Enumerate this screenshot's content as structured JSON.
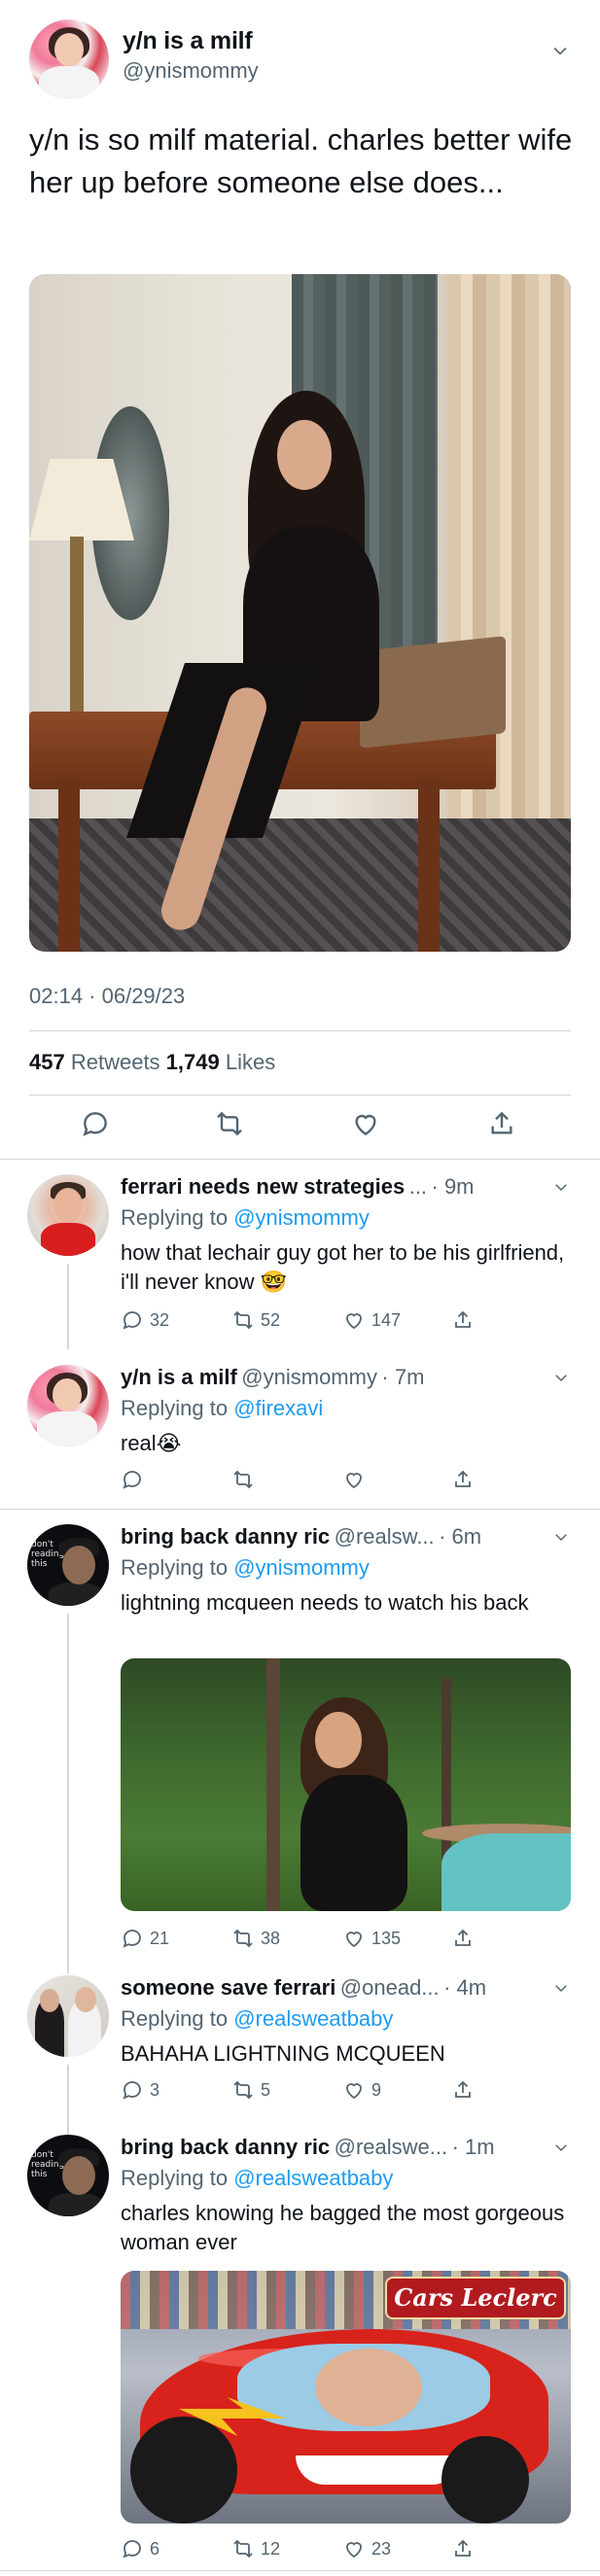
{
  "main_tweet": {
    "name": "y/n is a milf",
    "handle": "@ynismommy",
    "text": "y/n is so milf material. charles better wife her up before someone else does...",
    "timestamp": "02:14 · 06/29/23",
    "retweets": "457",
    "retweets_label": "Retweets",
    "likes": "1,749",
    "likes_label": "Likes"
  },
  "replies": [
    {
      "name": "ferrari needs new strategies",
      "handle": "...",
      "time": "· 9m",
      "replying_label": "Replying to",
      "replying_to": "@ynismommy",
      "text": "how that lechair guy got her to be his girlfriend, i'll never know",
      "emoji": "🤓",
      "reply_count": "32",
      "retweet_count": "52",
      "like_count": "147"
    },
    {
      "name": "y/n is a milf",
      "handle": "@ynismommy",
      "time": "· 7m",
      "replying_label": "Replying to",
      "replying_to": "@firexavi",
      "text": "real",
      "emoji": "😭",
      "reply_count": "",
      "retweet_count": "",
      "like_count": ""
    },
    {
      "name": "bring back danny ric",
      "handle": "@realsw...",
      "time": "· 6m",
      "replying_label": "Replying to",
      "replying_to": "@ynismommy",
      "text": "lightning mcqueen needs to watch his back",
      "reply_count": "21",
      "retweet_count": "38",
      "like_count": "135"
    },
    {
      "name": "someone save ferrari",
      "handle": "@onead...",
      "time": "· 4m",
      "replying_label": "Replying to",
      "replying_to": "@realsweatbaby",
      "text": "BAHAHA LIGHTNING MCQUEEN",
      "reply_count": "3",
      "retweet_count": "5",
      "like_count": "9"
    },
    {
      "name": "bring back danny ric",
      "handle": "@realswe...",
      "time": "· 1m",
      "replying_label": "Replying to",
      "replying_to": "@realsweatbaby",
      "text": "charles knowing he bagged the most gorgeous woman ever",
      "image_logo": "Cars Leclerc",
      "reply_count": "6",
      "retweet_count": "12",
      "like_count": "23"
    }
  ],
  "avatar_text": "don't reading this",
  "colors": {
    "text": "#0f1419",
    "secondary": "#536471",
    "link": "#1d9bf0",
    "divider": "#cfd9de"
  },
  "icons": [
    "chevron-down-icon",
    "reply-icon",
    "retweet-icon",
    "like-icon",
    "share-icon"
  ]
}
